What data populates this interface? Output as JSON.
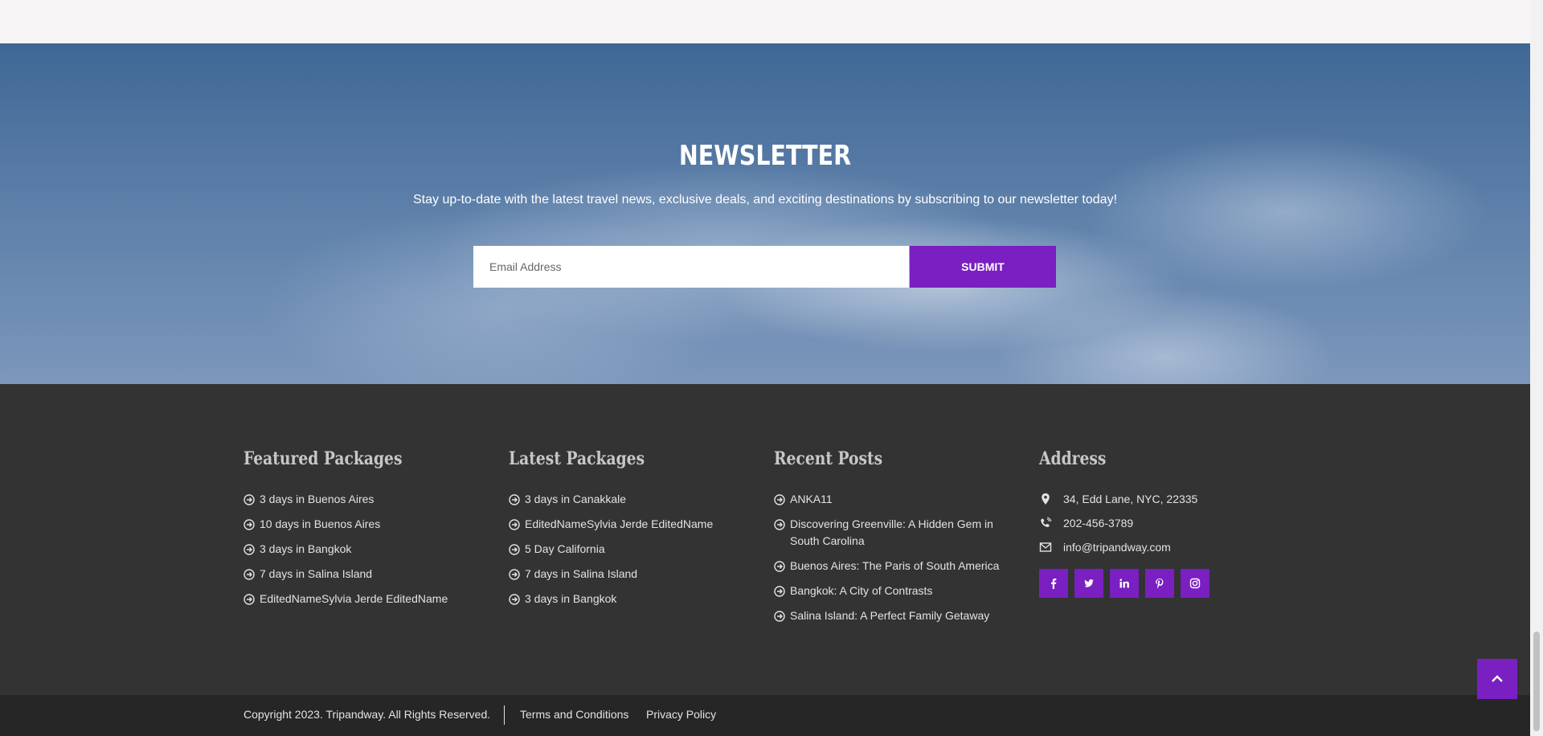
{
  "newsletter": {
    "title": "NEWSLETTER",
    "description": "Stay up-to-date with the latest travel news, exclusive deals, and exciting destinations by subscribing to our newsletter today!",
    "email_placeholder": "Email Address",
    "submit_label": "SUBMIT"
  },
  "footer": {
    "featured": {
      "heading": "Featured Packages",
      "items": [
        "3 days in Buenos Aires",
        "10 days in Buenos Aires",
        "3 days in Bangkok",
        "7 days in Salina Island",
        "EditedNameSylvia Jerde EditedName"
      ]
    },
    "latest": {
      "heading": "Latest Packages",
      "items": [
        "3 days in Canakkale",
        "EditedNameSylvia Jerde EditedName",
        "5 Day California",
        "7 days in Salina Island",
        "3 days in Bangkok"
      ]
    },
    "recent": {
      "heading": "Recent Posts",
      "items": [
        "ANKA11",
        "Discovering Greenville: A Hidden Gem in South Carolina",
        "Buenos Aires: The Paris of South America",
        "Bangkok: A City of Contrasts",
        "Salina Island: A Perfect Family Getaway"
      ]
    },
    "address": {
      "heading": "Address",
      "street": "34, Edd Lane, NYC, 22335",
      "phone": "202-456-3789",
      "email": "info@tripandway.com",
      "social_icons": [
        "facebook-icon",
        "twitter-icon",
        "linkedin-icon",
        "pinterest-icon",
        "instagram-icon"
      ]
    }
  },
  "bottom_bar": {
    "copyright": "Copyright 2023. Tripandway. All Rights Reserved.",
    "terms": "Terms and Conditions",
    "privacy": "Privacy Policy"
  },
  "colors": {
    "accent": "#7a1fc1",
    "footer_bg": "#333333",
    "bottom_bg": "#262626"
  }
}
